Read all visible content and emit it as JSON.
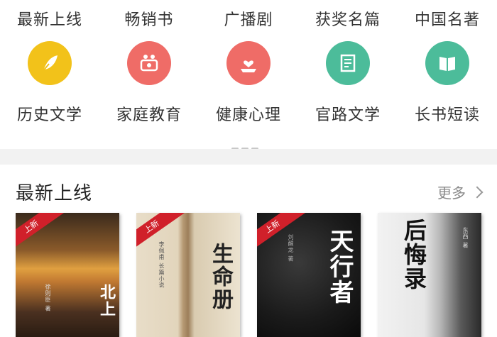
{
  "categories_row1": [
    "最新上线",
    "畅销书",
    "广播剧",
    "获奖名篇",
    "中国名著"
  ],
  "categories_row2": [
    {
      "label": "历史文学",
      "icon": "feather-icon",
      "color": "#f2c21a"
    },
    {
      "label": "家庭教育",
      "icon": "family-icon",
      "color": "#ef6c67"
    },
    {
      "label": "健康心理",
      "icon": "heart-hand-icon",
      "color": "#ef6c67"
    },
    {
      "label": "官路文学",
      "icon": "document-icon",
      "color": "#4cbc9a"
    },
    {
      "label": "长书短读",
      "icon": "book-icon",
      "color": "#4cbc9a"
    }
  ],
  "section": {
    "title": "最新上线",
    "more_label": "更多"
  },
  "books": [
    {
      "title": "北上",
      "ribbon": "上新"
    },
    {
      "title": "生命册",
      "ribbon": "上新"
    },
    {
      "title": "天行者",
      "ribbon": "上新"
    },
    {
      "title": "后悔录",
      "ribbon": ""
    }
  ]
}
